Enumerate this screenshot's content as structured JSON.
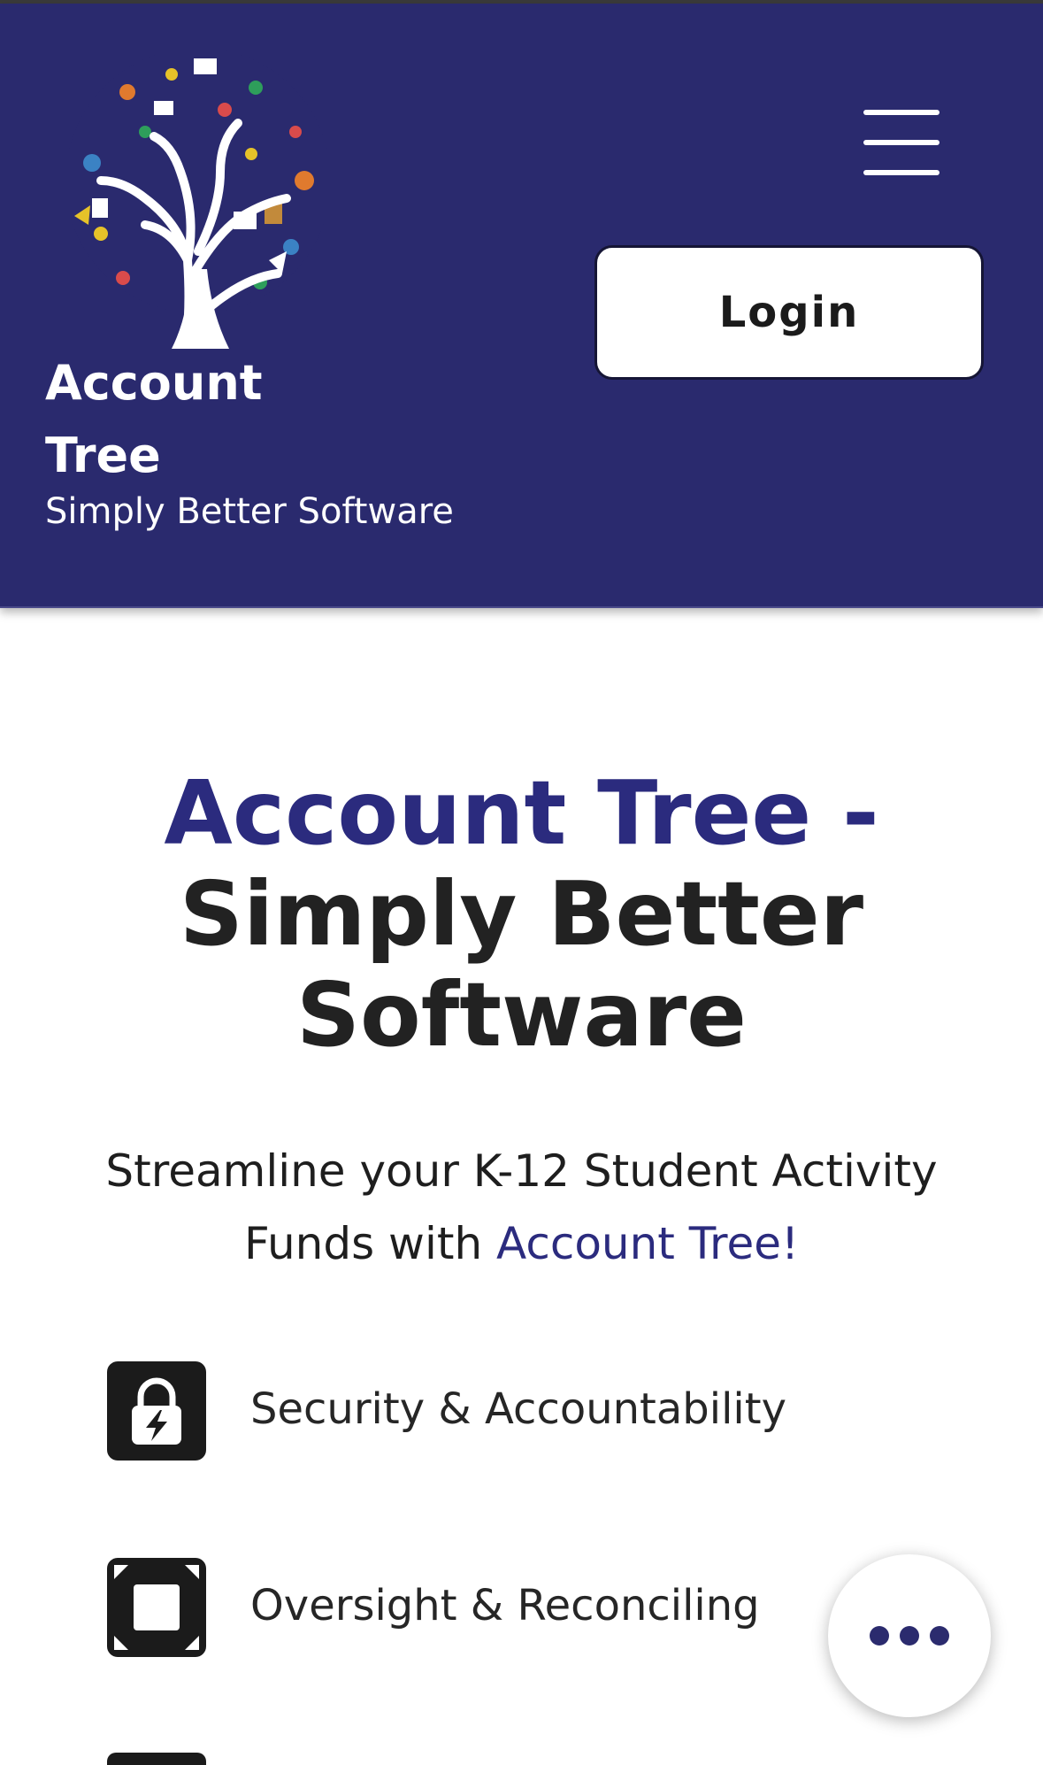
{
  "header": {
    "brand_name": "Account Tree",
    "tagline": "Simply Better Software",
    "login_label": "Login",
    "menu_icon": "hamburger-menu-icon",
    "logo_icon": "tree-logo-icon",
    "background_color": "#2a2a6e"
  },
  "hero": {
    "title_accent": "Account Tree -",
    "title_rest": "Simply Better Software",
    "subtitle_text": "Streamline your K-12 Student Activity Funds with ",
    "subtitle_accent": "Account Tree!",
    "accent_color": "#2b2b7e"
  },
  "features": [
    {
      "label": "Security & Accountability",
      "icon": "lock-bolt-icon"
    },
    {
      "label": "Oversight & Reconciling",
      "icon": "frame-corners-icon"
    }
  ],
  "fab": {
    "icon": "more-dots-icon"
  }
}
